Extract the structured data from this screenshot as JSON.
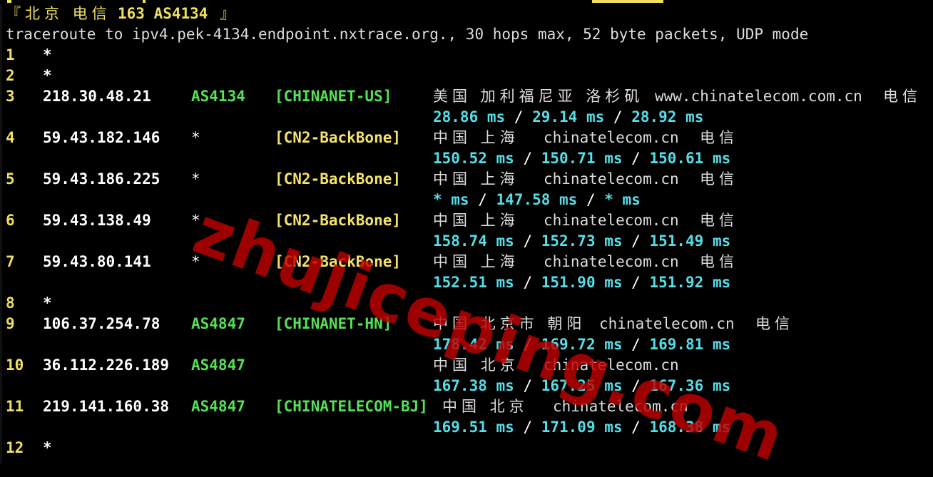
{
  "header": {
    "location_label": "『北京 电信 ",
    "asn_label": "163 AS4134",
    "close_bracket": " 』"
  },
  "command_line": "traceroute to ipv4.pek-4134.endpoint.nxtrace.org., 30 hops max, 52 byte packets, UDP mode",
  "hops": [
    {
      "num": "1",
      "ip": "*"
    },
    {
      "num": "2",
      "ip": "*"
    },
    {
      "num": "3",
      "ip": "218.30.48.21",
      "asn": "AS4134",
      "tag": "[CHINANET-US]",
      "geo": "美国 加利福尼亚 洛杉矶",
      "domain": "www.chinatelecom.com.cn",
      "isp": "电信",
      "rtt": [
        "28.86 ms",
        "29.14 ms",
        "28.92 ms"
      ]
    },
    {
      "num": "4",
      "ip": "59.43.182.146",
      "asn": "*",
      "tag": "[CN2-BackBone]",
      "geo": "中国 上海",
      "domain": "chinatelecom.cn",
      "isp": "电信",
      "rtt": [
        "150.52 ms",
        "150.71 ms",
        "150.61 ms"
      ]
    },
    {
      "num": "5",
      "ip": "59.43.186.225",
      "asn": "*",
      "tag": "[CN2-BackBone]",
      "geo": "中国 上海",
      "domain": "chinatelecom.cn",
      "isp": "电信",
      "rtt": [
        "* ms",
        "147.58 ms",
        "* ms"
      ]
    },
    {
      "num": "6",
      "ip": "59.43.138.49",
      "asn": "*",
      "tag": "[CN2-BackBone]",
      "geo": "中国 上海",
      "domain": "chinatelecom.cn",
      "isp": "电信",
      "rtt": [
        "158.74 ms",
        "152.73 ms",
        "151.49 ms"
      ]
    },
    {
      "num": "7",
      "ip": "59.43.80.141",
      "asn": "*",
      "tag": "[CN2-BackBone]",
      "geo": "中国 上海",
      "domain": "chinatelecom.cn",
      "isp": "电信",
      "rtt": [
        "152.51 ms",
        "151.90 ms",
        "151.92 ms"
      ]
    },
    {
      "num": "8",
      "ip": "*"
    },
    {
      "num": "9",
      "ip": "106.37.254.78",
      "asn": "AS4847",
      "tag": "[CHINANET-HN]",
      "geo": "中国 北京市 朝阳",
      "domain": "chinatelecom.cn",
      "isp": "电信",
      "rtt": [
        "178.42 ms",
        "169.72 ms",
        "169.81 ms"
      ]
    },
    {
      "num": "10",
      "ip": "36.112.226.189",
      "asn": "AS4847",
      "tag": "",
      "geo": "中国 北京",
      "domain": "chinatelecom.cn",
      "isp": "",
      "rtt": [
        "167.38 ms",
        "167.25 ms",
        "167.36 ms"
      ]
    },
    {
      "num": "11",
      "ip": "219.141.160.38",
      "asn": "AS4847",
      "tag": "[CHINATELECOM-BJ]",
      "geo": "中国 北京",
      "domain": "chinatelecom.cn",
      "isp": "",
      "rtt": [
        "169.51 ms",
        "171.09 ms",
        "168.38 ms"
      ]
    },
    {
      "num": "12",
      "ip": "*"
    }
  ],
  "rtt_separator": " / ",
  "watermark": "zhujiceping.com",
  "colors": {
    "background": "#000000",
    "hop_number": "#f0e060",
    "asn": "#55e055",
    "tag": "#f5e26a",
    "rtt": "#55dde8",
    "watermark": "#be0000"
  }
}
